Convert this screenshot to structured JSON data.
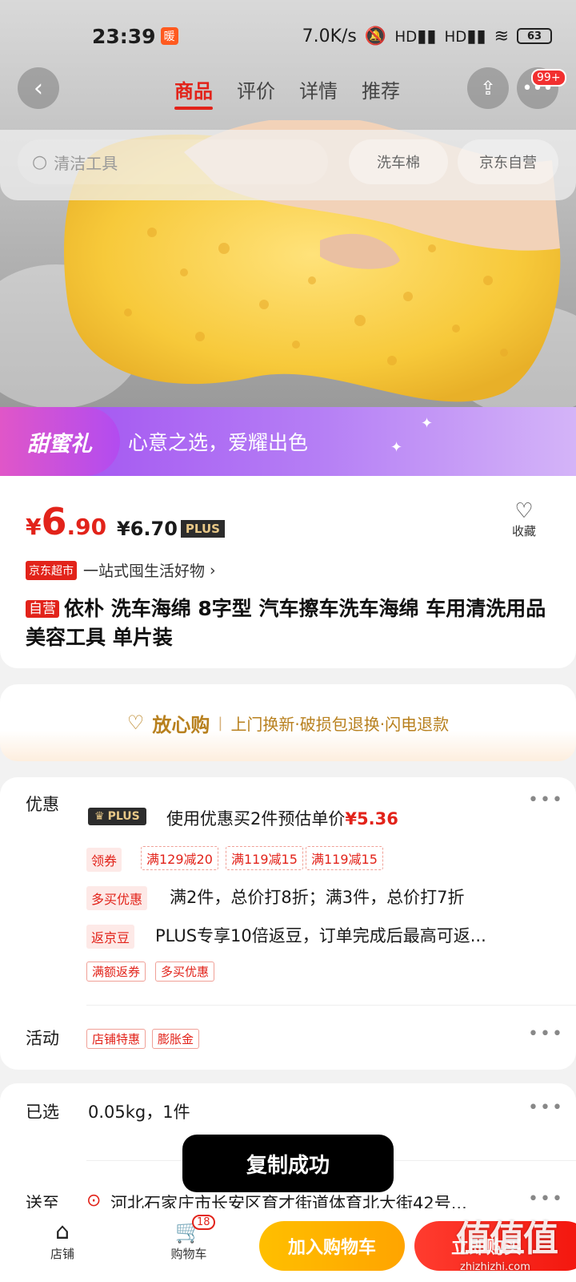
{
  "status_bar": {
    "time": "23:39",
    "notif_badge": "暖",
    "net_speed": "7.0K/s",
    "signal_1": "HD",
    "signal_2": "HD",
    "battery": "63"
  },
  "nav": {
    "tabs": [
      {
        "label": "商品",
        "active": true
      },
      {
        "label": "评价",
        "active": false
      },
      {
        "label": "详情",
        "active": false
      },
      {
        "label": "推荐",
        "active": false
      }
    ],
    "message_badge": "99+"
  },
  "search": {
    "placeholder": "清洁工具",
    "chips": [
      "洗车棉",
      "京东自营"
    ]
  },
  "promo": {
    "logo": "甜蜜礼",
    "text": "心意之选，爱耀出色"
  },
  "price": {
    "yen": "¥",
    "integer": "6",
    "decimal": ".90",
    "plus_price": "¥6.70",
    "plus_tag": "PLUS",
    "favorite_label": "收藏"
  },
  "market": {
    "tag": "京东超市",
    "text": "一站式囤生活好物",
    "chevron": "›"
  },
  "product": {
    "self_tag": "自营",
    "title": "依朴 洗车海绵 8字型 汽车擦车洗车海绵 车用清洗用品 美容工具 单片装"
  },
  "assurance": {
    "title": "放心购",
    "separator": "|",
    "text": "上门换新·破损包退换·闪电退款"
  },
  "offers": {
    "label": "优惠",
    "plus_badge": "PLUS",
    "plus_line_prefix": "使用优惠买2件预估单价",
    "plus_line_price": "¥5.36",
    "coupon_label": "领券",
    "coupons": [
      "满129减20",
      "满119减15",
      "满119减15"
    ],
    "multi_label": "多买优惠",
    "multi_text": "满2件，总价打8折；满3件，总价打7折",
    "bean_label": "返京豆",
    "bean_text": "PLUS专享10倍返豆，订单完成后最高可返...",
    "extra_tags": [
      "满额返券",
      "多买优惠"
    ],
    "dots": "•••"
  },
  "activity": {
    "label": "活动",
    "tags": [
      "店铺特惠",
      "膨胀金"
    ],
    "dots": "•••"
  },
  "selected": {
    "label": "已选",
    "value": "0.05kg，1件",
    "dots": "•••"
  },
  "ship": {
    "label": "送至",
    "address": "河北石家庄市长安区育才街道体育北大街42号...",
    "dots": "•••"
  },
  "toast": {
    "text": "复制成功"
  },
  "bottom_bar": {
    "shop_label": "店铺",
    "cart_label": "购物车",
    "cart_count": "18",
    "add_to_cart": "加入购物车",
    "buy_now": "立即购买"
  },
  "watermark": {
    "text": "值值值",
    "url": "zhizhizhi.com"
  },
  "colors": {
    "accent": "#e2231a",
    "gold": "#b8801e",
    "cart_button": "#ffb000",
    "buy_button": "#f2140c",
    "promo_purple": "#a04cf0"
  }
}
